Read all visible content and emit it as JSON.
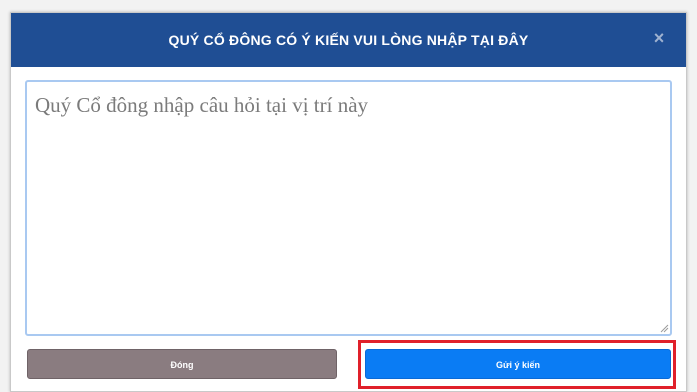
{
  "modal": {
    "title": "QUÝ CỔ ĐÔNG CÓ Ý KIẾN VUI LÒNG NHẬP TẠI ĐÂY",
    "close_symbol": "×",
    "question": {
      "value": "",
      "placeholder": "Quý Cổ đông nhập câu hỏi tại vị trí này"
    },
    "buttons": {
      "close_label": "Đóng",
      "send_label": "Gửi ý kiến"
    }
  },
  "colors": {
    "header": "#1f4e94",
    "close_button": "#8a7c80",
    "send_button": "#0a7cf4",
    "highlight": "#e0202a"
  },
  "icons": {
    "close": "close-icon",
    "resize": "resize-grip-icon"
  }
}
